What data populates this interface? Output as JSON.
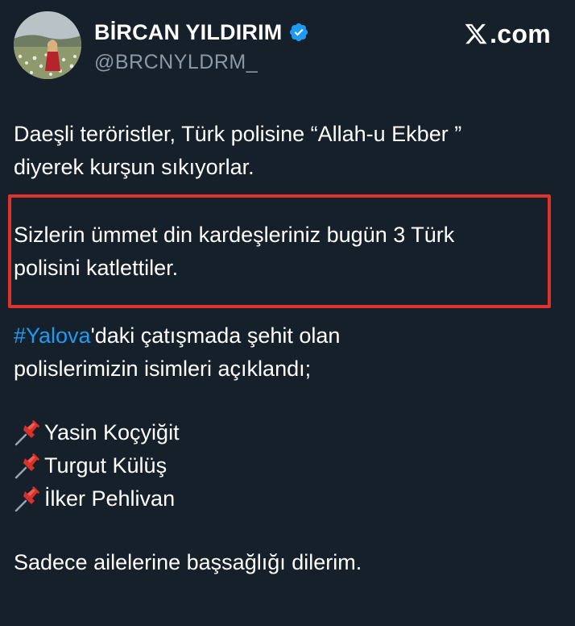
{
  "header": {
    "display_name": "BİRCAN YILDIRIM",
    "handle": "@BRCNYLDRM_",
    "verified_icon": "verified-badge-icon",
    "brand_text": ".com",
    "brand_icon": "x-logo-icon"
  },
  "tweet": {
    "paragraph_1_line_1": "Daeşli teröristler, Türk polisine “Allah-u Ekber ”",
    "paragraph_1_line_2": "diyerek kurşun sıkıyorlar.",
    "highlight_line_1": "Sizlerin ümmet din kardeşleriniz bugün 3 Türk",
    "highlight_line_2": "polisini katlettiler.",
    "hashtag": "#Yalova",
    "hashtag_rest": "'daki çatışmada şehit olan",
    "paragraph_3_line_2": "polislerimizin isimleri açıklandı;",
    "names": [
      "Yasin Koçyiğit",
      "Turgut Külüş",
      "İlker Pehlivan"
    ],
    "list_icon": "pushpin-icon",
    "closing": "Sadece ailelerine başsağlığı dilerim."
  },
  "colors": {
    "background": "#15202b",
    "text": "#ffffff",
    "secondary_text": "#8b98a5",
    "link": "#1d9bf0",
    "highlight_border": "#e0312a",
    "verified": "#1d9bf0"
  }
}
